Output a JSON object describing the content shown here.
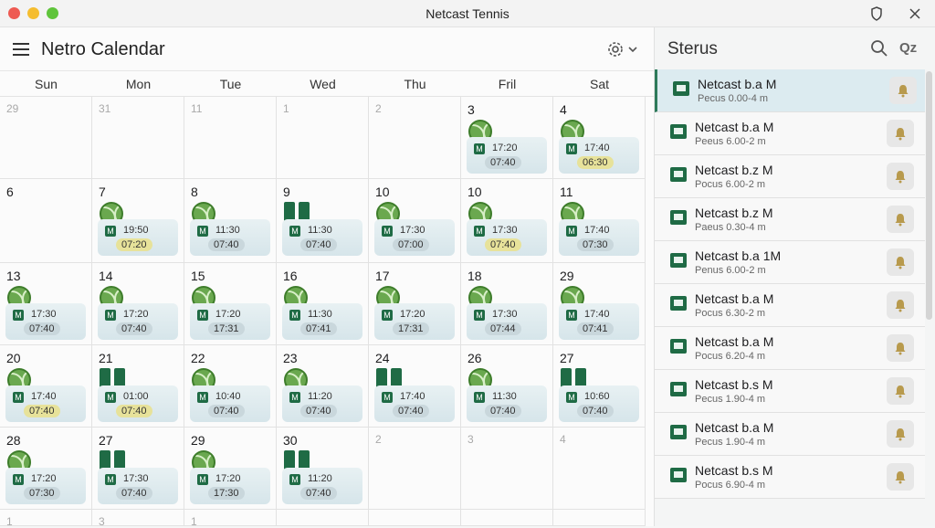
{
  "window": {
    "title": "Netcast Tennis"
  },
  "app": {
    "title": "Netro Calendar"
  },
  "weekdays": [
    "Sun",
    "Mon",
    "Tue",
    "Wed",
    "Thu",
    "Fril",
    "Sat"
  ],
  "calendar": {
    "rows": [
      [
        "29",
        "31",
        "11",
        "1",
        "2",
        "3",
        "4"
      ],
      [
        "6",
        "7",
        "8",
        "9",
        "10",
        "10",
        "11"
      ],
      [
        "13",
        "14",
        "15",
        "16",
        "17",
        "18",
        "29"
      ],
      [
        "20",
        "21",
        "22",
        "23",
        "24",
        "26",
        "27"
      ],
      [
        "28",
        "27",
        "29",
        "30",
        "2",
        "3",
        "4"
      ],
      [
        "1",
        "3",
        "1",
        "",
        "",
        "",
        ""
      ]
    ],
    "events": [
      {
        "row": 0,
        "col": 5,
        "t1": "17:20",
        "t2": "07:40",
        "hl": false
      },
      {
        "row": 0,
        "col": 6,
        "t1": "17:40",
        "t2": "06:30",
        "hl": true
      },
      {
        "row": 1,
        "col": 1,
        "t1": "19:50",
        "t2": "07:20",
        "hl": true
      },
      {
        "row": 1,
        "col": 2,
        "t1": "11:30",
        "t2": "07:40",
        "hl": false
      },
      {
        "row": 1,
        "col": 3,
        "t1": "11:30",
        "t2": "07:40",
        "hl": false
      },
      {
        "row": 1,
        "col": 4,
        "t1": "17:30",
        "t2": "07:00",
        "hl": false
      },
      {
        "row": 1,
        "col": 5,
        "t1": "17:30",
        "t2": "07:40",
        "hl": true
      },
      {
        "row": 1,
        "col": 6,
        "t1": "17:40",
        "t2": "07:30",
        "hl": false
      },
      {
        "row": 2,
        "col": 0,
        "t1": "17:30",
        "t2": "07:40",
        "hl": false
      },
      {
        "row": 2,
        "col": 1,
        "t1": "17:20",
        "t2": "07:40",
        "hl": false
      },
      {
        "row": 2,
        "col": 2,
        "t1": "17:20",
        "t2": "17:31",
        "hl": false
      },
      {
        "row": 2,
        "col": 3,
        "t1": "11:30",
        "t2": "07:41",
        "hl": false
      },
      {
        "row": 2,
        "col": 4,
        "t1": "17:20",
        "t2": "17:31",
        "hl": false
      },
      {
        "row": 2,
        "col": 5,
        "t1": "17:30",
        "t2": "07:44",
        "hl": false
      },
      {
        "row": 2,
        "col": 6,
        "t1": "17:40",
        "t2": "07:41",
        "hl": false
      },
      {
        "row": 3,
        "col": 0,
        "t1": "17:40",
        "t2": "07:40",
        "hl": true
      },
      {
        "row": 3,
        "col": 1,
        "t1": "01:00",
        "t2": "07:40",
        "hl": true
      },
      {
        "row": 3,
        "col": 2,
        "t1": "10:40",
        "t2": "07:40",
        "hl": false
      },
      {
        "row": 3,
        "col": 3,
        "t1": "11:20",
        "t2": "07:40",
        "hl": false
      },
      {
        "row": 3,
        "col": 4,
        "t1": "17:40",
        "t2": "07:40",
        "hl": false
      },
      {
        "row": 3,
        "col": 5,
        "t1": "11:30",
        "t2": "07:40",
        "hl": false
      },
      {
        "row": 3,
        "col": 6,
        "t1": "10:60",
        "t2": "07:40",
        "hl": false
      },
      {
        "row": 4,
        "col": 0,
        "t1": "17:20",
        "t2": "07:30",
        "hl": false
      },
      {
        "row": 4,
        "col": 1,
        "t1": "17:30",
        "t2": "07:40",
        "hl": false
      },
      {
        "row": 4,
        "col": 2,
        "t1": "17:20",
        "t2": "17:30",
        "hl": false
      },
      {
        "row": 4,
        "col": 3,
        "t1": "11:20",
        "t2": "07:40",
        "hl": false
      }
    ]
  },
  "sidebar": {
    "title": "Sterus",
    "qz_label": "Qz",
    "items": [
      {
        "name": "Netcast b.a M",
        "sub": "Pecus 0.00-4 m",
        "selected": true
      },
      {
        "name": "Netcast b.a M",
        "sub": "Peeus 6.00-2 m",
        "selected": false
      },
      {
        "name": "Netcast b.z M",
        "sub": "Pocus 6.00-2 m",
        "selected": false
      },
      {
        "name": "Netcast b.z M",
        "sub": "Paeus 0.30-4 m",
        "selected": false
      },
      {
        "name": "Netcast b.a 1M",
        "sub": "Penus 6.00-2 m",
        "selected": false
      },
      {
        "name": "Netcast b.a M",
        "sub": "Pocus 6.30-2 m",
        "selected": false
      },
      {
        "name": "Netcast b.a M",
        "sub": "Pocus 6.20-4 m",
        "selected": false
      },
      {
        "name": "Netcast b.s M",
        "sub": "Pecus 1.90-4 m",
        "selected": false
      },
      {
        "name": "Netcast b.a M",
        "sub": "Pecus 1.90-4 m",
        "selected": false
      },
      {
        "name": "Netcast b.s M",
        "sub": "Pocus 6.90-4 m",
        "selected": false
      }
    ]
  }
}
